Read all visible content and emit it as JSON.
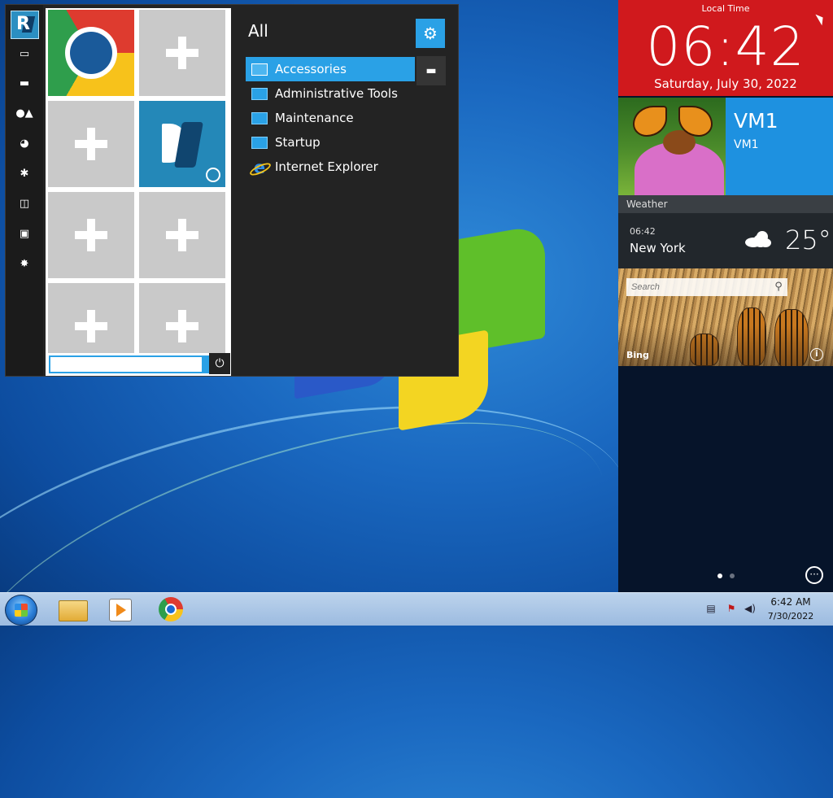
{
  "start_menu": {
    "all_label": "All",
    "programs": [
      {
        "label": "Accessories"
      },
      {
        "label": "Administrative Tools"
      },
      {
        "label": "Maintenance"
      },
      {
        "label": "Startup"
      },
      {
        "label": "Internet Explorer"
      }
    ],
    "search_placeholder": "",
    "left_bar_icons": [
      "monitor-icon",
      "folder-icon",
      "users-icon",
      "network-icon",
      "settings-icon",
      "chart-icon",
      "display-icon",
      "gear-icon"
    ]
  },
  "right_panel": {
    "clock": {
      "label": "Local Time",
      "time": "06:42",
      "date": "Saturday, July 30, 2022"
    },
    "vm": {
      "title": "VM1",
      "subtitle": "VM1"
    },
    "weather": {
      "header": "Weather",
      "time": "06:42",
      "city": "New York",
      "temp": "25°"
    },
    "bing": {
      "search_placeholder": "Search",
      "label": "Bing"
    }
  },
  "taskbar": {
    "time": "6:42 AM",
    "date": "7/30/2022"
  },
  "colors": {
    "accent": "#2aa1e6",
    "clock_red": "#d0191d",
    "vm_blue": "#1e91e0"
  }
}
